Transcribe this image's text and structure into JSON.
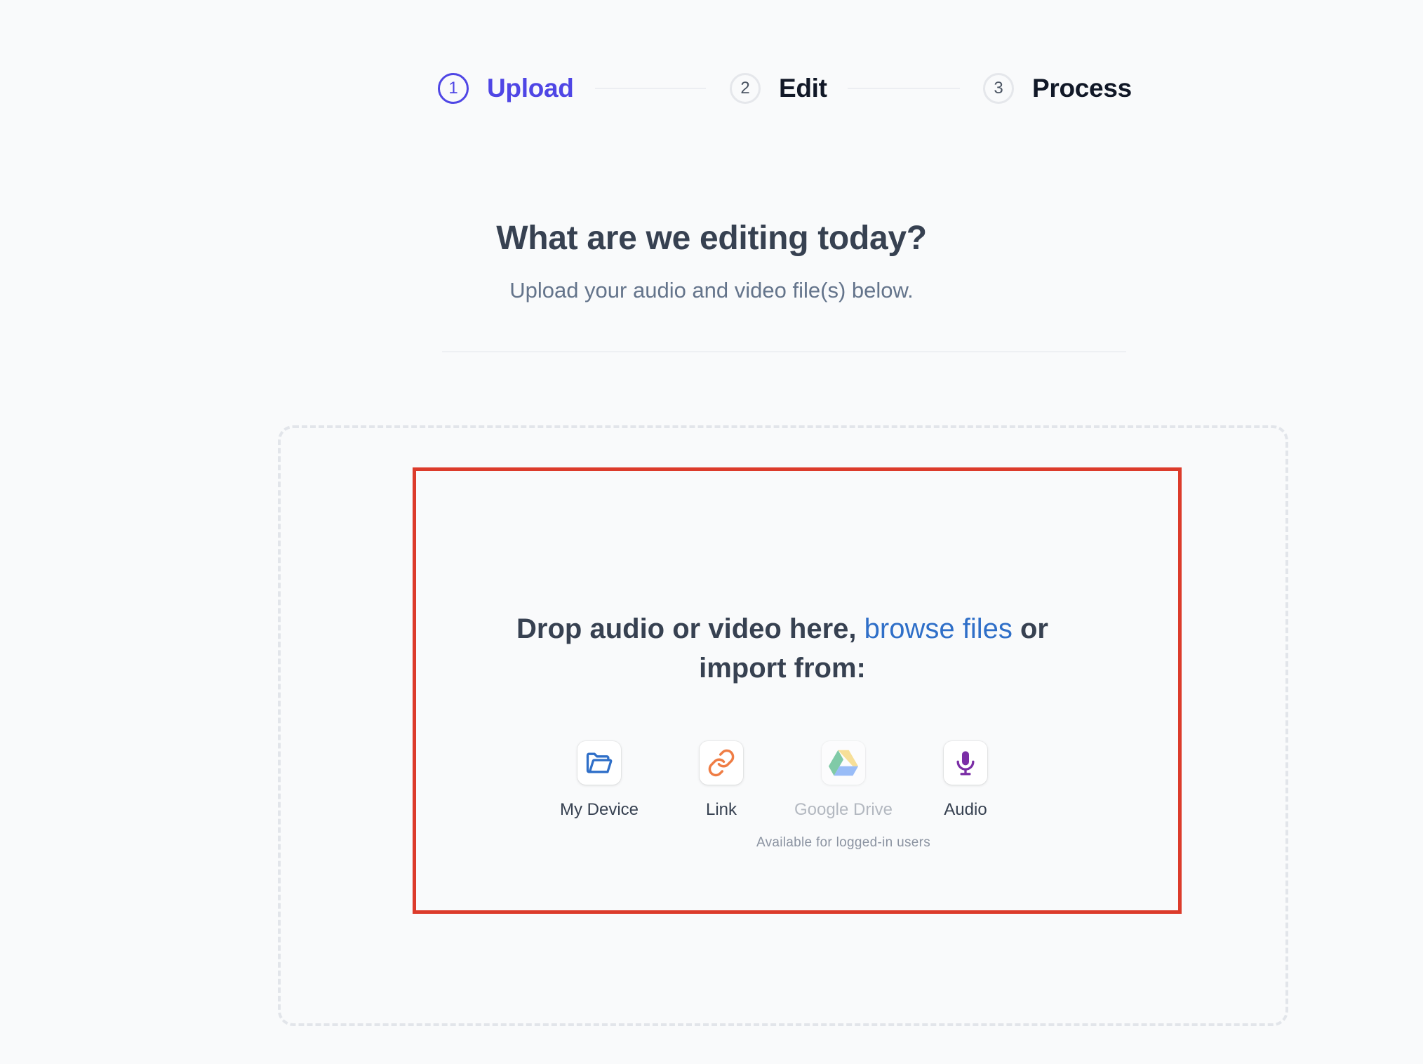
{
  "stepper": {
    "steps": [
      {
        "number": "1",
        "label": "Upload",
        "state": "active"
      },
      {
        "number": "2",
        "label": "Edit",
        "state": "inactive"
      },
      {
        "number": "3",
        "label": "Process",
        "state": "inactive"
      }
    ]
  },
  "main": {
    "title": "What are we editing today?",
    "subtitle": "Upload your audio and video file(s) below."
  },
  "dropzone": {
    "prompt_start": "Drop audio or video here, ",
    "browse_link": "browse files",
    "prompt_end": " or import from:",
    "sources": [
      {
        "label": "My Device",
        "icon": "folder-open-icon",
        "enabled": true
      },
      {
        "label": "Link",
        "icon": "link-icon",
        "enabled": true
      },
      {
        "label": "Google Drive",
        "icon": "google-drive-icon",
        "enabled": false
      },
      {
        "label": "Audio",
        "icon": "microphone-icon",
        "enabled": true
      }
    ],
    "login_note": "Available for logged-in users"
  },
  "colors": {
    "accent": "#4f46e5",
    "link": "#2f6fc8",
    "highlight": "#dc3b2b",
    "device_icon": "#2f6fc8",
    "link_icon": "#ef7d45",
    "audio_icon": "#7b2ea6"
  }
}
